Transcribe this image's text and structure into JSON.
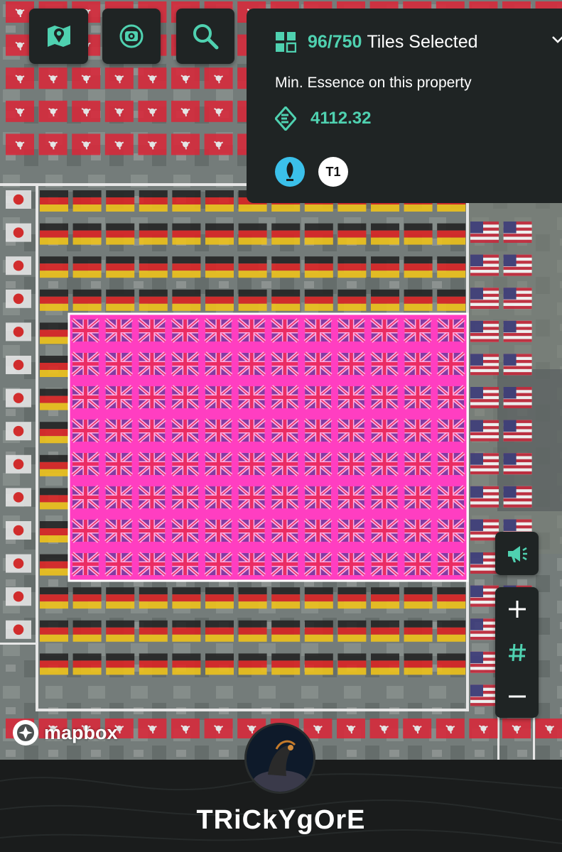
{
  "selection": {
    "count": "96/750",
    "label": "Tiles Selected",
    "min_essence_label": "Min. Essence on this property",
    "essence_value": "4112.32",
    "tier_badge": "T1"
  },
  "attribution": {
    "logo_text": "mapbox"
  },
  "user": {
    "name": "TRiCkYgOrE"
  },
  "icons": {
    "map_button": "map-pin-icon",
    "camera_button": "camera-icon",
    "search_button": "search-icon",
    "tiles": "tiles-grid-icon",
    "essence": "essence-icon",
    "quill_badge": "quill-icon",
    "announce_button": "megaphone-icon",
    "zoom_in": "plus-icon",
    "grid_toggle": "hash-icon",
    "zoom_out": "minus-icon"
  },
  "colors": {
    "accent": "#4fd1b0",
    "panel": "#1f2424",
    "selection_fill": "#ff3fc2",
    "quill_badge": "#3bc0ea"
  }
}
